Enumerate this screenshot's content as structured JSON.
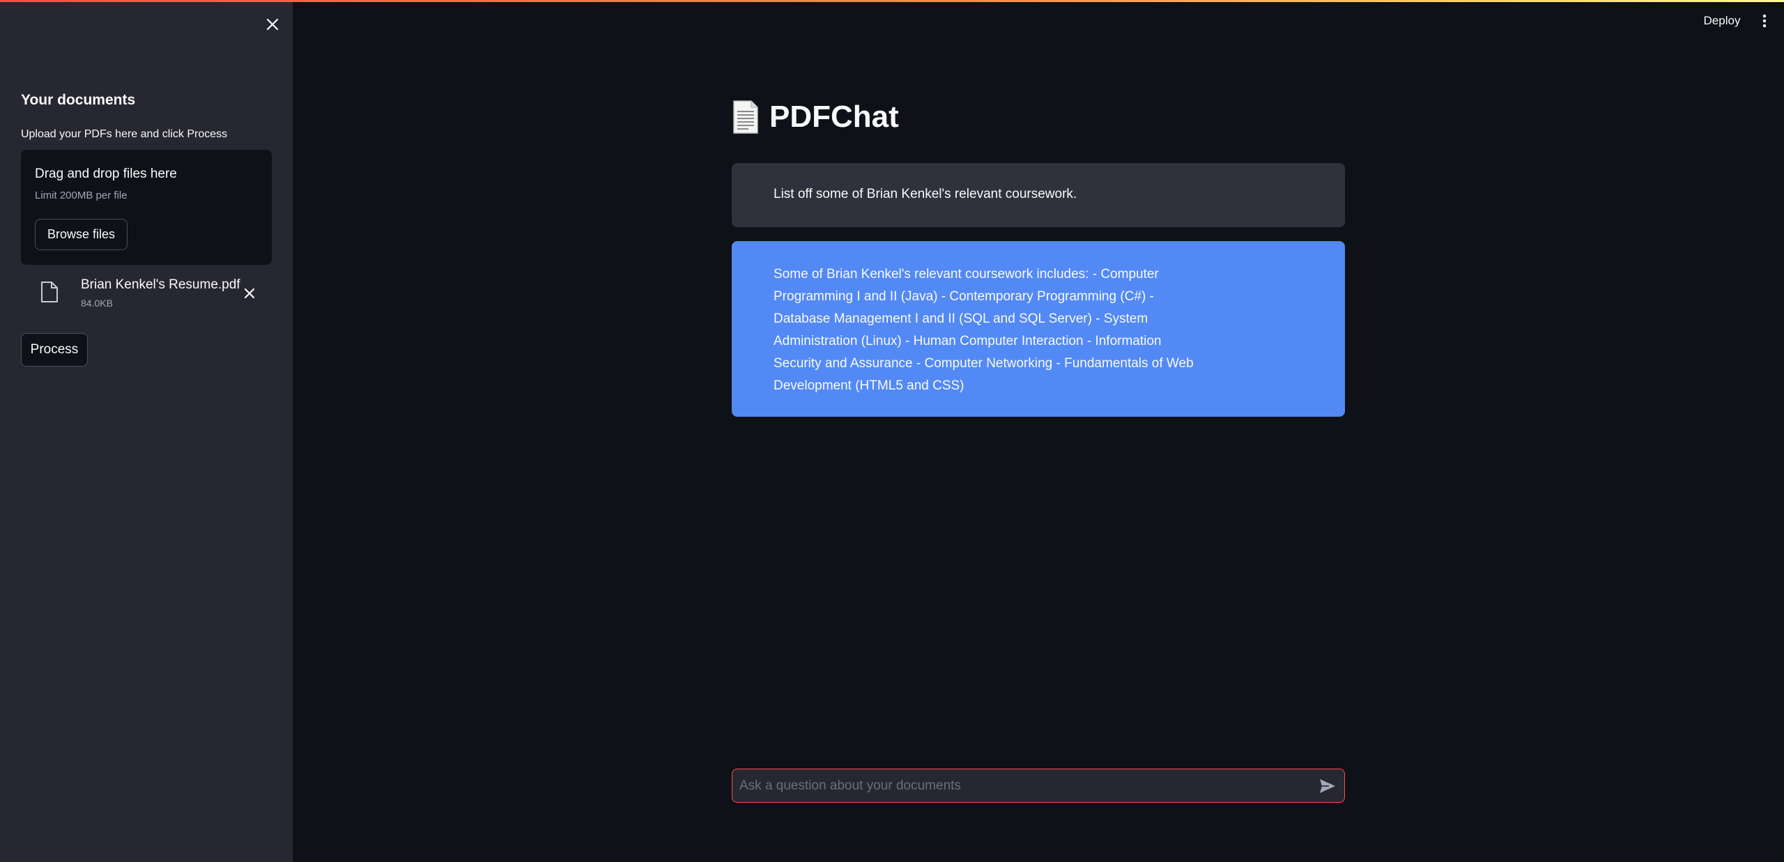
{
  "sidebar": {
    "title": "Your documents",
    "upload_label": "Upload your PDFs here and click Process",
    "dropzone": {
      "title": "Drag and drop files here",
      "limit": "Limit 200MB per file",
      "browse_label": "Browse files"
    },
    "uploaded_file": {
      "name": "Brian Kenkel's Resume.pdf",
      "size": "84.0KB"
    },
    "process_label": "Process"
  },
  "header": {
    "deploy_label": "Deploy"
  },
  "main": {
    "title": "PDFChat",
    "messages": [
      {
        "role": "user",
        "text": "List off some of Brian Kenkel's relevant coursework."
      },
      {
        "role": "bot",
        "text": "Some of Brian Kenkel's relevant coursework includes: - Computer Programming I and II (Java) - Contemporary Programming (C#) - Database Management I and II (SQL and SQL Server) - System Administration (Linux) - Human Computer Interaction - Information Security and Assurance - Computer Networking - Fundamentals of Web Development (HTML5 and CSS)"
      }
    ],
    "chat_input": {
      "placeholder": "Ask a question about your documents",
      "value": ""
    }
  },
  "icons": {
    "sidebar_close": "close-icon",
    "file": "file-icon",
    "file_remove": "close-icon",
    "send": "send-icon",
    "menu": "kebab-menu-icon",
    "title_emoji": "page-facing-up-icon"
  },
  "colors": {
    "background": "#0e1117",
    "sidebar": "#262730",
    "user_message": "#2f323d",
    "bot_message": "#5289f5",
    "accent": "#ff4b4b"
  }
}
